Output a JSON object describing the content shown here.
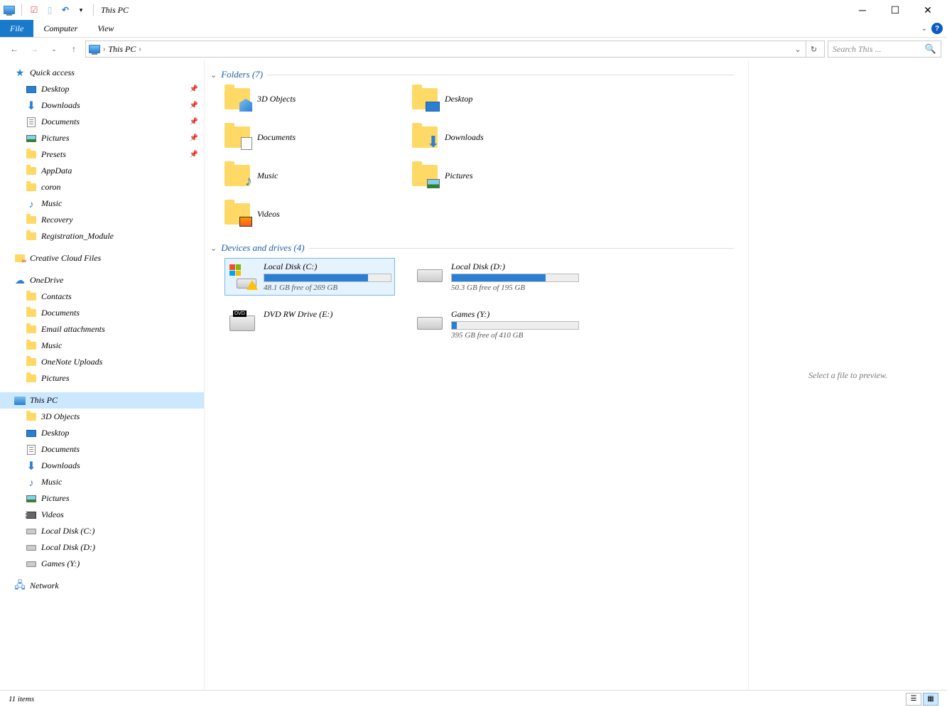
{
  "titlebar": {
    "title": "This PC"
  },
  "ribbon": {
    "tabs": {
      "file": "File",
      "computer": "Computer",
      "view": "View"
    }
  },
  "address": {
    "crumb": "This PC",
    "search_placeholder": "Search This ..."
  },
  "sidebar": {
    "quick_access": "Quick access",
    "qa_items": [
      {
        "label": "Desktop",
        "icon": "desktop",
        "pinned": true
      },
      {
        "label": "Downloads",
        "icon": "download",
        "pinned": true
      },
      {
        "label": "Documents",
        "icon": "doc",
        "pinned": true
      },
      {
        "label": "Pictures",
        "icon": "pic",
        "pinned": true
      },
      {
        "label": "Presets",
        "icon": "folder",
        "pinned": true
      },
      {
        "label": "AppData",
        "icon": "folder",
        "pinned": false
      },
      {
        "label": "coron",
        "icon": "folder",
        "pinned": false
      },
      {
        "label": "Music",
        "icon": "music",
        "pinned": false
      },
      {
        "label": "Recovery",
        "icon": "folder",
        "pinned": false
      },
      {
        "label": "Registration_Module",
        "icon": "folder",
        "pinned": false
      }
    ],
    "creative_cloud": "Creative Cloud Files",
    "onedrive": "OneDrive",
    "od_items": [
      {
        "label": "Contacts"
      },
      {
        "label": "Documents"
      },
      {
        "label": "Email attachments"
      },
      {
        "label": "Music"
      },
      {
        "label": "OneNote Uploads"
      },
      {
        "label": "Pictures"
      }
    ],
    "this_pc": "This PC",
    "pc_items": [
      {
        "label": "3D Objects",
        "icon": "folder"
      },
      {
        "label": "Desktop",
        "icon": "desktop"
      },
      {
        "label": "Documents",
        "icon": "doc"
      },
      {
        "label": "Downloads",
        "icon": "download"
      },
      {
        "label": "Music",
        "icon": "music"
      },
      {
        "label": "Pictures",
        "icon": "pic"
      },
      {
        "label": "Videos",
        "icon": "video"
      },
      {
        "label": "Local Disk (C:)",
        "icon": "disk"
      },
      {
        "label": "Local Disk (D:)",
        "icon": "disk"
      },
      {
        "label": "Games (Y:)",
        "icon": "disk"
      }
    ],
    "network": "Network"
  },
  "content": {
    "folders_header": "Folders (7)",
    "folders": [
      {
        "name": "3D Objects",
        "overlay": "3d"
      },
      {
        "name": "Desktop",
        "overlay": "desktop"
      },
      {
        "name": "Documents",
        "overlay": "doc"
      },
      {
        "name": "Downloads",
        "overlay": "down"
      },
      {
        "name": "Music",
        "overlay": "music"
      },
      {
        "name": "Pictures",
        "overlay": "pic"
      },
      {
        "name": "Videos",
        "overlay": "video"
      }
    ],
    "drives_header": "Devices and drives (4)",
    "drives": [
      {
        "name": "Local Disk (C:)",
        "free": "48.1 GB free of 269 GB",
        "fill": 82,
        "icon": "os",
        "selected": true
      },
      {
        "name": "Local Disk (D:)",
        "free": "50.3 GB free of 195 GB",
        "fill": 74,
        "icon": "hdd",
        "selected": false
      },
      {
        "name": "DVD RW Drive (E:)",
        "free": "",
        "fill": -1,
        "icon": "dvd",
        "selected": false
      },
      {
        "name": "Games (Y:)",
        "free": "395 GB free of 410 GB",
        "fill": 4,
        "icon": "hdd",
        "selected": false
      }
    ]
  },
  "preview": {
    "placeholder": "Select a file to preview."
  },
  "statusbar": {
    "count": "11 items"
  }
}
